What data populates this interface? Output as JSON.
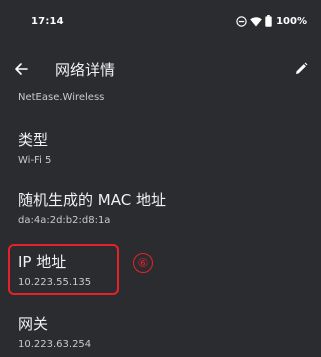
{
  "status_bar": {
    "time": "17:14",
    "battery_percent": "100%",
    "icons": [
      "do-not-disturb-icon",
      "wifi-icon",
      "battery-icon"
    ]
  },
  "app_bar": {
    "title": "网络详情",
    "back_icon": "arrow-left-icon",
    "edit_icon": "pencil-icon"
  },
  "details": {
    "clipped_value": "NetEase.Wireless",
    "items": [
      {
        "title": "类型",
        "value": "Wi-Fi 5"
      },
      {
        "title": "随机生成的 MAC 地址",
        "value": "da:4a:2d:b2:d8:1a"
      },
      {
        "title": "IP 地址",
        "value": "10.223.55.135"
      },
      {
        "title": "网关",
        "value": "10.223.63.254"
      }
    ]
  },
  "annotation": {
    "marker": "⑥",
    "color": "#e5222a"
  },
  "colors": {
    "background": "#2b2c30",
    "text_primary": "#f1f1f3",
    "text_secondary": "#c9cacd"
  }
}
